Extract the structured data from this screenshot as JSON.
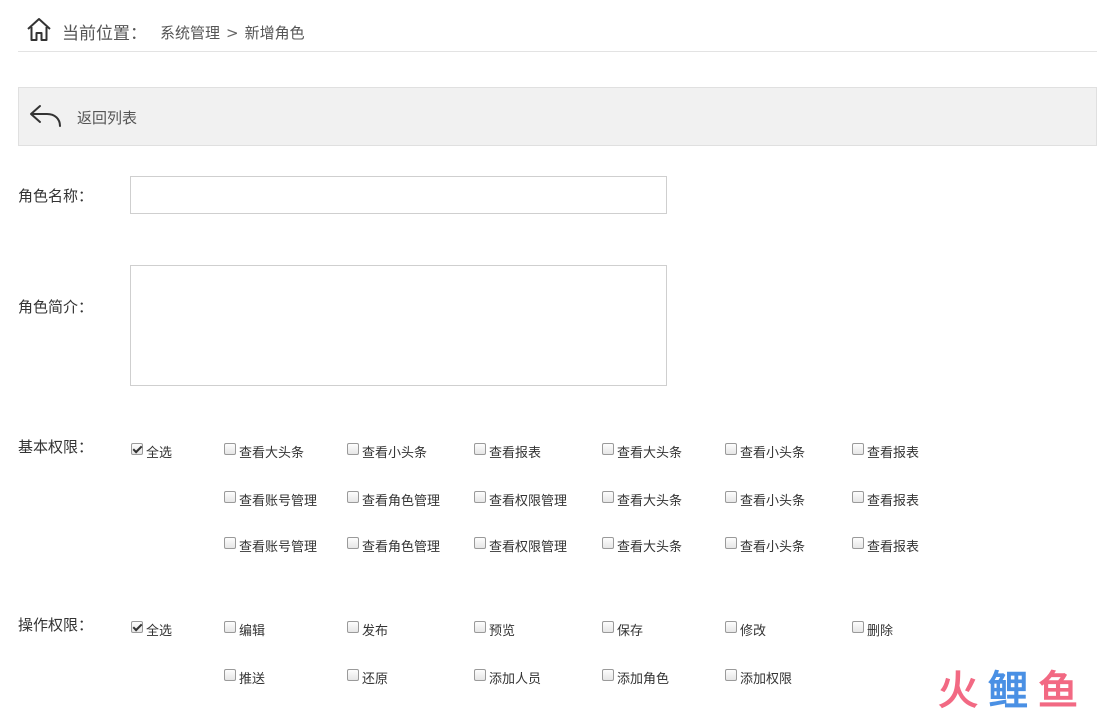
{
  "breadcrumb": {
    "label": "当前位置：",
    "path": [
      "系统管理",
      "新增角色"
    ],
    "separator": ">"
  },
  "back": {
    "label": "返回列表"
  },
  "form": {
    "name_label": "角色名称：",
    "name_value": "",
    "desc_label": "角色简介：",
    "desc_value": ""
  },
  "basic": {
    "label": "基本权限：",
    "select_all": {
      "label": "全选",
      "checked": true
    },
    "rows": [
      [
        "查看大头条",
        "查看小头条",
        "查看报表",
        "查看大头条",
        "查看小头条",
        "查看报表"
      ],
      [
        "查看账号管理",
        "查看角色管理",
        "查看权限管理",
        "查看大头条",
        "查看小头条",
        "查看报表"
      ],
      [
        "查看账号管理",
        "查看角色管理",
        "查看权限管理",
        "查看大头条",
        "查看小头条",
        "查看报表"
      ]
    ]
  },
  "ops": {
    "label": "操作权限：",
    "select_all": {
      "label": "全选",
      "checked": true
    },
    "rows": [
      [
        "编辑",
        "发布",
        "预览",
        "保存",
        "修改",
        "删除"
      ],
      [
        "推送",
        "还原",
        "添加人员",
        "添加角色",
        "添加权限"
      ]
    ]
  },
  "colors": {
    "breadcrumb_text": "#555555",
    "backbar_bg": "#f1f1f1",
    "border": "#cfcfcf",
    "watermark_red": "#f0506e",
    "watermark_blue": "#2b7de0"
  },
  "icons": {
    "home": "home-icon",
    "back": "reply-arrow-icon",
    "logo": "watermark-logo"
  },
  "watermark": "火鲤鱼"
}
